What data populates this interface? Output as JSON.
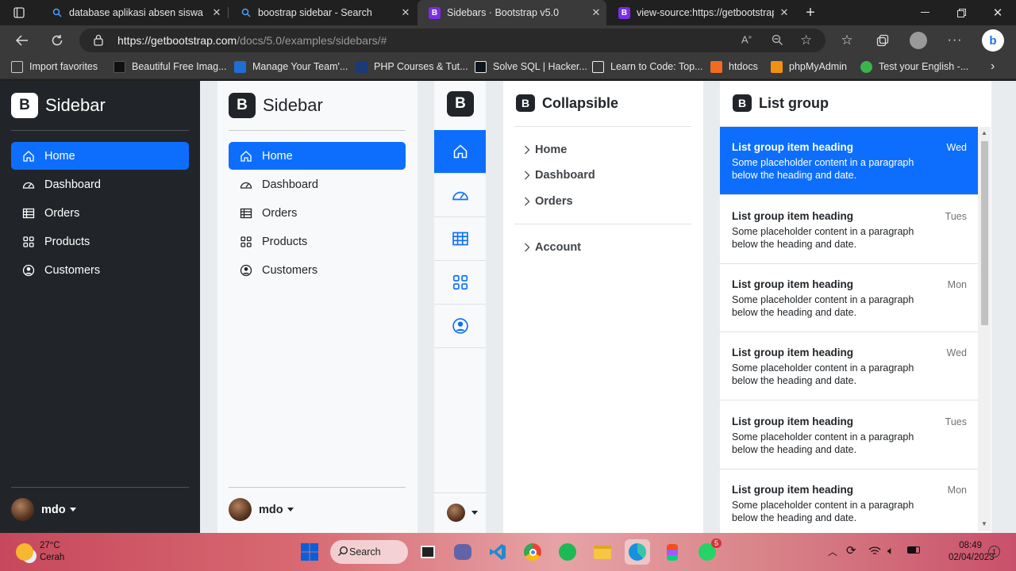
{
  "browser": {
    "tabs": [
      {
        "title": "database aplikasi absen siswa - B",
        "icon": "search-icon",
        "active": false
      },
      {
        "title": "boostrap sidebar - Search",
        "icon": "search-icon",
        "active": false
      },
      {
        "title": "Sidebars · Bootstrap v5.0",
        "icon": "bootstrap-logo",
        "active": true
      },
      {
        "title": "view-source:https://getbootstrap",
        "icon": "bootstrap-logo",
        "active": false
      }
    ],
    "url_domain": "https://getbootstrap.com",
    "url_path": "/docs/5.0/examples/sidebars/#",
    "favorites": [
      {
        "label": "Import favorites",
        "color": "#cccccc"
      },
      {
        "label": "Beautiful Free Imag...",
        "color": "#111111"
      },
      {
        "label": "Manage Your Team'...",
        "color": "#1f6ed4"
      },
      {
        "label": "PHP Courses & Tut...",
        "color": "#1b3a78"
      },
      {
        "label": "Solve SQL | Hacker...",
        "color": "#0e141e"
      },
      {
        "label": "Learn to Code: Top...",
        "color": "#eeeeee"
      },
      {
        "label": "htdocs",
        "color": "#f26b22"
      },
      {
        "label": "phpMyAdmin",
        "color": "#f29111"
      },
      {
        "label": "Test your English -...",
        "color": "#3cb44b"
      }
    ]
  },
  "dark_sidebar": {
    "brand": "Sidebar",
    "logo": "B",
    "items": [
      {
        "label": "Home",
        "icon": "home-icon",
        "active": true
      },
      {
        "label": "Dashboard",
        "icon": "speedometer-icon",
        "active": false
      },
      {
        "label": "Orders",
        "icon": "table-icon",
        "active": false
      },
      {
        "label": "Products",
        "icon": "grid-icon",
        "active": false
      },
      {
        "label": "Customers",
        "icon": "person-circle-icon",
        "active": false
      }
    ],
    "user": "mdo"
  },
  "light_sidebar": {
    "brand": "Sidebar",
    "logo": "B",
    "items": [
      {
        "label": "Home",
        "icon": "home-icon",
        "active": true
      },
      {
        "label": "Dashboard",
        "icon": "speedometer-icon",
        "active": false
      },
      {
        "label": "Orders",
        "icon": "table-icon",
        "active": false
      },
      {
        "label": "Products",
        "icon": "grid-icon",
        "active": false
      },
      {
        "label": "Customers",
        "icon": "person-circle-icon",
        "active": false
      }
    ],
    "user": "mdo"
  },
  "icon_sidebar": {
    "logo": "B",
    "icons": [
      "home-icon",
      "speedometer-icon",
      "table-icon",
      "grid-icon",
      "person-circle-icon"
    ]
  },
  "collapsible": {
    "brand": "Collapsible",
    "logo": "B",
    "items": [
      "Home",
      "Dashboard",
      "Orders"
    ],
    "account": "Account"
  },
  "list_group": {
    "brand": "List group",
    "logo": "B",
    "items": [
      {
        "heading": "List group item heading",
        "text": "Some placeholder content in a paragraph below the heading and date.",
        "day": "Wed",
        "active": true
      },
      {
        "heading": "List group item heading",
        "text": "Some placeholder content in a paragraph below the heading and date.",
        "day": "Tues",
        "active": false
      },
      {
        "heading": "List group item heading",
        "text": "Some placeholder content in a paragraph below the heading and date.",
        "day": "Mon",
        "active": false
      },
      {
        "heading": "List group item heading",
        "text": "Some placeholder content in a paragraph below the heading and date.",
        "day": "Wed",
        "active": false
      },
      {
        "heading": "List group item heading",
        "text": "Some placeholder content in a paragraph below the heading and date.",
        "day": "Tues",
        "active": false
      },
      {
        "heading": "List group item heading",
        "text": "Some placeholder content in a paragraph below the heading and date.",
        "day": "Mon",
        "active": false
      }
    ]
  },
  "taskbar": {
    "temperature": "27°C",
    "condition": "Cerah",
    "search_label": "Search",
    "time": "08:49",
    "date": "02/04/2023",
    "notifications": "1",
    "whatsapp_badge": "5"
  },
  "colors": {
    "primary": "#0d6efd",
    "dark": "#212529",
    "light": "#f8f9fa"
  }
}
